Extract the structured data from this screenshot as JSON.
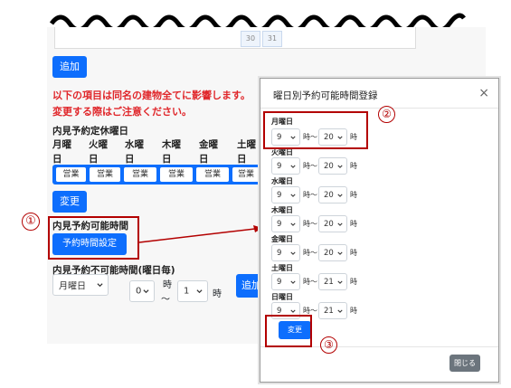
{
  "top_cells": [
    "30",
    "31"
  ],
  "buttons": {
    "add_top": "追加",
    "change": "変更",
    "reservation_time_settings": "予約時間設定",
    "add_bottom": "追加"
  },
  "warning": {
    "line1": "以下の項目は同名の建物全てに影響します。",
    "line2": "変更する際はご注意ください。"
  },
  "regular_closed": {
    "heading": "内見予約定休曜日",
    "days": [
      {
        "top": "月曜",
        "bottom": "日"
      },
      {
        "top": "火曜",
        "bottom": "日"
      },
      {
        "top": "水曜",
        "bottom": "日"
      },
      {
        "top": "木曜",
        "bottom": "日"
      },
      {
        "top": "金曜",
        "bottom": "日"
      },
      {
        "top": "土曜",
        "bottom": "日"
      }
    ],
    "status_label": "営業"
  },
  "available_time": {
    "heading": "内見予約可能時間"
  },
  "unavailable_time": {
    "heading": "内見予約不可能時間(曜日毎)",
    "weekday_value": "月曜日",
    "from_value": "0",
    "from_unit": "時",
    "tilde": "〜",
    "to_value": "1",
    "to_unit": "時"
  },
  "callouts": [
    "①",
    "②",
    "③"
  ],
  "modal": {
    "title": "曜日別予約可能時間登録",
    "close_symbol": "×",
    "hour_unit": "時",
    "tilde_unit": "時〜",
    "rows": [
      {
        "day": "月曜日",
        "from": "9",
        "to": "20"
      },
      {
        "day": "火曜日",
        "from": "9",
        "to": "20"
      },
      {
        "day": "水曜日",
        "from": "9",
        "to": "20"
      },
      {
        "day": "木曜日",
        "from": "9",
        "to": "20"
      },
      {
        "day": "金曜日",
        "from": "9",
        "to": "20"
      },
      {
        "day": "土曜日",
        "from": "9",
        "to": "21"
      },
      {
        "day": "日曜日",
        "from": "9",
        "to": "21"
      }
    ],
    "change_label": "変更",
    "close_label": "閉じる"
  },
  "colors": {
    "primary": "#0d6efd",
    "warning": "#e0262a",
    "annotation": "#b30000"
  }
}
